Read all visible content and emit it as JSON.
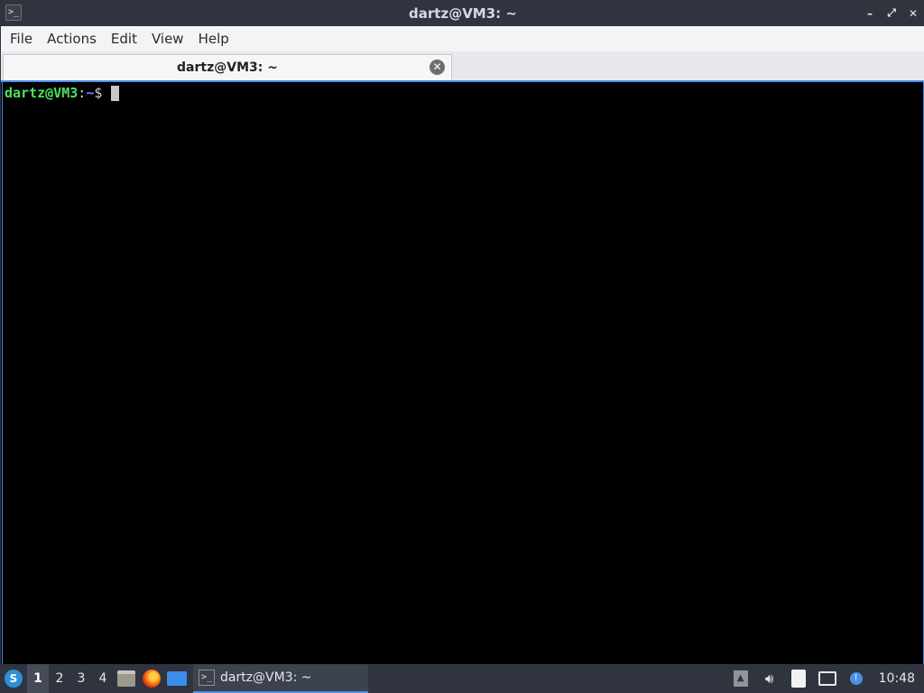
{
  "window": {
    "title": "dartz@VM3: ~",
    "icon": "terminal-icon",
    "buttons": [
      "minimize-icon",
      "maximize-icon",
      "close-icon"
    ]
  },
  "menubar": {
    "items": [
      "File",
      "Actions",
      "Edit",
      "View",
      "Help"
    ]
  },
  "tabs": [
    {
      "label": "dartz@VM3: ~",
      "active": true
    }
  ],
  "terminal": {
    "prompt_user_host": "dartz@VM3",
    "prompt_colon": ":",
    "prompt_path": "~",
    "prompt_symbol": "$",
    "input": ""
  },
  "taskbar": {
    "desktops": [
      "1",
      "2",
      "3",
      "4"
    ],
    "active_desktop": "1",
    "quicklaunch": [
      "file-manager-icon",
      "firefox-icon",
      "show-desktop-icon"
    ],
    "task": {
      "label": "dartz@VM3: ~",
      "icon": "terminal-icon"
    },
    "tray": [
      "tray-expand-icon",
      "volume-icon",
      "clipboard-icon",
      "network-icon",
      "update-icon"
    ],
    "clock": "10:48"
  },
  "colors": {
    "titlebar_bg": "#2f343f",
    "accent": "#4d8ee6",
    "prompt_user": "#4ce35a",
    "prompt_path": "#6b8cff",
    "terminal_bg": "#000000"
  }
}
